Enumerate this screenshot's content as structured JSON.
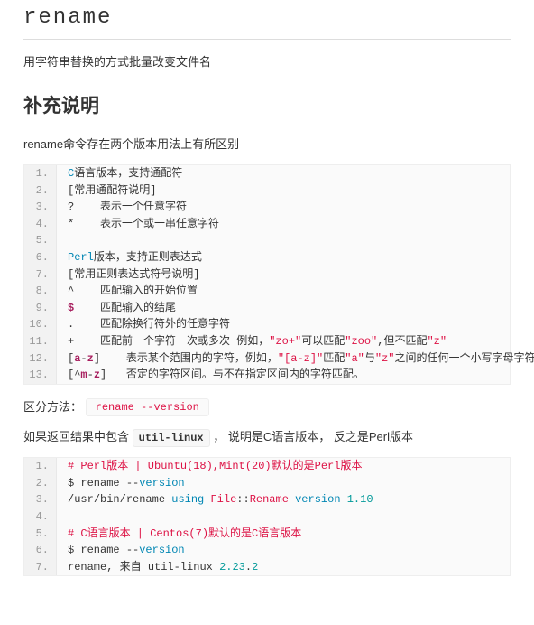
{
  "title": "rename",
  "short_desc": "用字符串替换的方式批量改变文件名",
  "section_heading": "补充说明",
  "intro_line": "rename命令存在两个版本用法上有所区别",
  "code1": {
    "lines": [
      [
        [
          "kw",
          "C"
        ],
        [
          "var",
          "语言版本，支持通配符"
        ]
      ],
      [
        [
          "punc",
          "["
        ],
        [
          "var",
          "常用通配符说明"
        ],
        [
          "punc",
          "]"
        ]
      ],
      [
        [
          "punc",
          "?    "
        ],
        [
          "var",
          "表示一个任意字符"
        ]
      ],
      [
        [
          "punc",
          "*    "
        ],
        [
          "var",
          "表示一个或一串任意字符"
        ]
      ],
      [],
      [
        [
          "kw",
          "Perl"
        ],
        [
          "var",
          "版本，支持正则表达式"
        ]
      ],
      [
        [
          "punc",
          "["
        ],
        [
          "var",
          "常用正则表达式符号说明"
        ],
        [
          "punc",
          "]"
        ]
      ],
      [
        [
          "punc",
          "^    "
        ],
        [
          "var",
          "匹配输入的开始位置"
        ]
      ],
      [
        [
          "mark",
          "$"
        ],
        [
          "var",
          "    匹配输入的结尾"
        ]
      ],
      [
        [
          "punc",
          ".    "
        ],
        [
          "var",
          "匹配除换行符外的任意字符"
        ]
      ],
      [
        [
          "punc",
          "+    "
        ],
        [
          "var",
          "匹配前一个字符一次或多次 例如，"
        ],
        [
          "str",
          "\"zo+\""
        ],
        [
          "var",
          "可以匹配"
        ],
        [
          "str",
          "\"zoo\""
        ],
        [
          "punc",
          ","
        ],
        [
          "var",
          "但不匹配"
        ],
        [
          "str",
          "\"z\""
        ]
      ],
      [
        [
          "punc",
          "["
        ],
        [
          "mark",
          "a"
        ],
        [
          "punc",
          "-"
        ],
        [
          "mark",
          "z"
        ],
        [
          "punc",
          "]    "
        ],
        [
          "var",
          "表示某个范围内的字符，例如，"
        ],
        [
          "str",
          "\"[a-z]\""
        ],
        [
          "var",
          "匹配"
        ],
        [
          "str",
          "\"a\""
        ],
        [
          "var",
          "与"
        ],
        [
          "str",
          "\"z\""
        ],
        [
          "var",
          "之间的任何一个小写字母字符。"
        ]
      ],
      [
        [
          "punc",
          "[^"
        ],
        [
          "mark",
          "m"
        ],
        [
          "punc",
          "-"
        ],
        [
          "mark",
          "z"
        ],
        [
          "punc",
          "]   "
        ],
        [
          "var",
          "否定的字符区间。与不在指定区间内的字符匹配。"
        ]
      ]
    ]
  },
  "diff_label": "区分方法：",
  "pill_text": "rename --version",
  "result_prefix": "如果返回结果中包含 ",
  "result_code": "util-linux",
  "result_suffix": " ， 说明是C语言版本， 反之是Perl版本",
  "code2": {
    "lines": [
      [
        [
          "red",
          "# Perl版本 | Ubuntu(18),Mint(20)默认的是Perl版本"
        ]
      ],
      [
        [
          "var",
          "$ rename "
        ],
        [
          "punc",
          "--"
        ],
        [
          "kw",
          "version"
        ]
      ],
      [
        [
          "punc",
          "/"
        ],
        [
          "var",
          "usr"
        ],
        [
          "punc",
          "/"
        ],
        [
          "var",
          "bin"
        ],
        [
          "punc",
          "/"
        ],
        [
          "var",
          "rename "
        ],
        [
          "kw",
          "using"
        ],
        [
          "var",
          " "
        ],
        [
          "red",
          "File"
        ],
        [
          "punc",
          "::"
        ],
        [
          "red",
          "Rename"
        ],
        [
          "var",
          " "
        ],
        [
          "kw",
          "version"
        ],
        [
          "var",
          " "
        ],
        [
          "num",
          "1.10"
        ]
      ],
      [],
      [
        [
          "red",
          "# C语言版本 | Centos(7)默认的是C语言版本"
        ]
      ],
      [
        [
          "var",
          "$ rename "
        ],
        [
          "punc",
          "--"
        ],
        [
          "kw",
          "version"
        ]
      ],
      [
        [
          "var",
          "rename"
        ],
        [
          "punc",
          ","
        ],
        [
          "var",
          " 来自 util"
        ],
        [
          "punc",
          "-"
        ],
        [
          "var",
          "linux "
        ],
        [
          "num",
          "2.23"
        ],
        [
          "punc",
          "."
        ],
        [
          "num",
          "2"
        ]
      ]
    ]
  }
}
